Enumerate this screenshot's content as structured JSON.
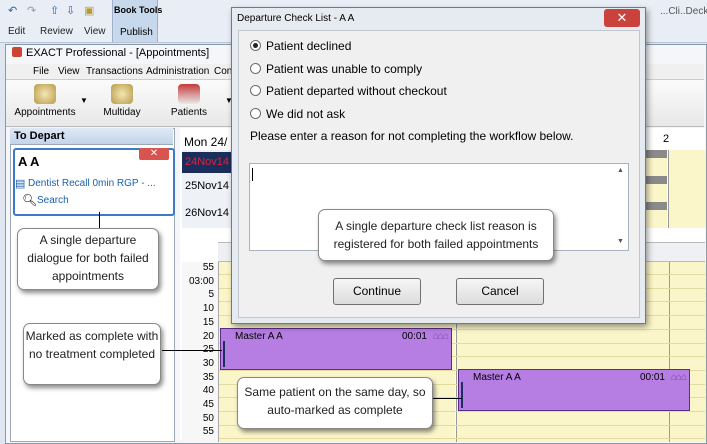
{
  "ribbon": {
    "tabs": [
      "Edit",
      "Review",
      "View"
    ],
    "book_tools": "Book Tools",
    "publish": "Publish",
    "clipped_title": "...Cli..Deck..."
  },
  "app": {
    "title": "EXACT Professional - [Appointments]",
    "menu": [
      "File",
      "View",
      "Transactions",
      "Administration",
      "Con"
    ],
    "toolbar": [
      "Appointments",
      "Multiday",
      "Patients"
    ]
  },
  "left_pane": {
    "header": "To Depart",
    "patient_name": "A A",
    "appointment": "Dentist Recall 0min RGP - ...",
    "search": "Search"
  },
  "calendar": {
    "header_date": "Mon 24/",
    "column_number": "2",
    "dates": [
      "24Nov14",
      "25Nov14",
      "26Nov14"
    ],
    "time_labels": [
      "55",
      "03:00",
      "5",
      "10",
      "15",
      "20",
      "25",
      "30",
      "35",
      "40",
      "45",
      "50",
      "55"
    ],
    "appointments": [
      {
        "label": "Master A A",
        "duration": "00:01"
      },
      {
        "label": "Master A A",
        "duration": "00:01"
      }
    ]
  },
  "dialog": {
    "title": "Departure Check List - A A",
    "options": [
      {
        "label": "Patient declined",
        "selected": true
      },
      {
        "label": "Patient was unable to comply",
        "selected": false
      },
      {
        "label": "Patient departed without checkout",
        "selected": false
      },
      {
        "label": "We did not ask",
        "selected": false
      }
    ],
    "prompt": "Please enter a reason for not completing the workflow below.",
    "reason_value": "",
    "continue_label": "Continue",
    "cancel_label": "Cancel"
  },
  "callouts": {
    "single_dialogue": "A single departure dialogue for both failed appointments",
    "single_reason": "A single departure check list reason is registered for both failed appointments",
    "marked_complete": "Marked as complete with no treatment completed",
    "auto_marked": "Same patient on the same day, so auto-marked as complete"
  },
  "colors": {
    "appointment_fill": "#b67ee3",
    "column_fill": "#fbf6c9",
    "today_date": "#d4142a"
  }
}
